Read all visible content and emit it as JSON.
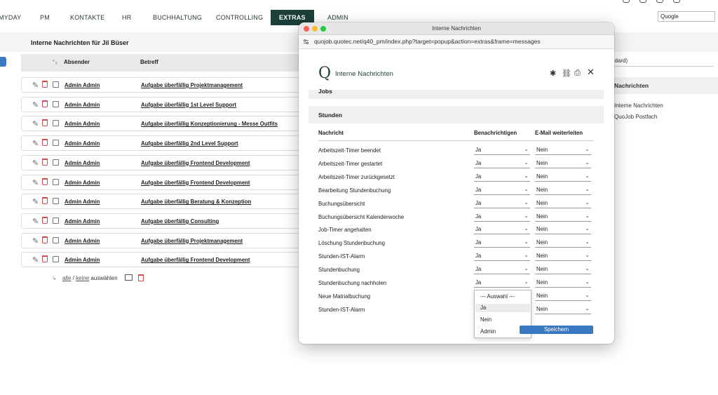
{
  "nav": {
    "items": [
      "MYDAY",
      "PM",
      "KONTAKTE",
      "HR",
      "BUCHHALTUNG",
      "CONTROLLING",
      "EXTRAS",
      "ADMIN"
    ],
    "active": "EXTRAS"
  },
  "search": {
    "value": "Quogle"
  },
  "page": {
    "title": "Interne Nachrichten für Jil Büser"
  },
  "table": {
    "headers": {
      "sender": "Absender",
      "subject": "Betreff"
    },
    "rows": [
      {
        "sender": "Admin Admin",
        "subject": "Aufgabe überfällig Projektmanagement"
      },
      {
        "sender": "Admin Admin",
        "subject": "Aufgabe überfällig 1st Level Support"
      },
      {
        "sender": "Admin Admin",
        "subject": "Aufgabe überfällig Konzeptionierung - Messe Outfits"
      },
      {
        "sender": "Admin Admin",
        "subject": "Aufgabe überfällig 2nd Level Support"
      },
      {
        "sender": "Admin Admin",
        "subject": "Aufgabe überfällig Frontend Development"
      },
      {
        "sender": "Admin Admin",
        "subject": "Aufgabe überfällig Frontend Development"
      },
      {
        "sender": "Admin Admin",
        "subject": "Aufgabe überfällig Beratung & Konzeption"
      },
      {
        "sender": "Admin Admin",
        "subject": "Aufgabe überfällig Consulting"
      },
      {
        "sender": "Admin Admin",
        "subject": "Aufgabe überfällig Projektmanagement"
      },
      {
        "sender": "Admin Admin",
        "subject": "Aufgabe überfällig Frontend Development"
      }
    ],
    "select_all": "alle",
    "select_none": "keine",
    "select_suffix": "auswählen"
  },
  "right": {
    "standard_fragment": "ndard)",
    "section_title": "Nachrichten",
    "links": [
      "Interne Nachrichten",
      "QuoJob Postfach"
    ]
  },
  "popup": {
    "window_title": "Interne Nachrichten",
    "url": "quojob.quotec.net/q40_pm/index.php?target=popup&action=extras&frame=messages",
    "logo": "Q",
    "heading": "Interne Nachrichten",
    "section_jobs": "Jobs",
    "section_stunden": "Stunden",
    "col_message": "Nachricht",
    "col_notify": "Benachrichtigen",
    "col_forward": "E-Mail weiterleiten",
    "settings": [
      {
        "name": "Arbeitszeit-Timer beendet",
        "notify": "Ja",
        "forward": "Nein"
      },
      {
        "name": "Arbeitszeit-Timer gestartet",
        "notify": "Ja",
        "forward": "Nein"
      },
      {
        "name": "Arbeitszeit-Timer zurückgesetzt",
        "notify": "Ja",
        "forward": "Nein"
      },
      {
        "name": "Bearbeitung Stundenbuchung",
        "notify": "Ja",
        "forward": "Nein"
      },
      {
        "name": "Buchungsübersicht",
        "notify": "Ja",
        "forward": "Nein"
      },
      {
        "name": "Buchungsübersicht Kalenderwoche",
        "notify": "Ja",
        "forward": "Nein"
      },
      {
        "name": "Job-Timer angehalten",
        "notify": "Ja",
        "forward": "Nein"
      },
      {
        "name": "Löschung Stundenbuchung",
        "notify": "Ja",
        "forward": "Nein"
      },
      {
        "name": "Stunden-IST-Alarm",
        "notify": "Ja",
        "forward": "Nein"
      },
      {
        "name": "Stundenbuchung",
        "notify": "Ja",
        "forward": "Nein"
      },
      {
        "name": "Stundenbuchung nachholen",
        "notify": "Ja",
        "forward": "Nein"
      },
      {
        "name": "Neue Matrialbuchung",
        "notify": "",
        "forward": "Nein"
      },
      {
        "name": "Stunden-IST-Alarm",
        "notify": "",
        "forward": "Nein"
      }
    ],
    "dropdown_options": [
      "--- Auswahl ---",
      "Ja",
      "Nein",
      "Admin"
    ],
    "dropdown_selected": "Ja",
    "save_label": "Speichern"
  }
}
